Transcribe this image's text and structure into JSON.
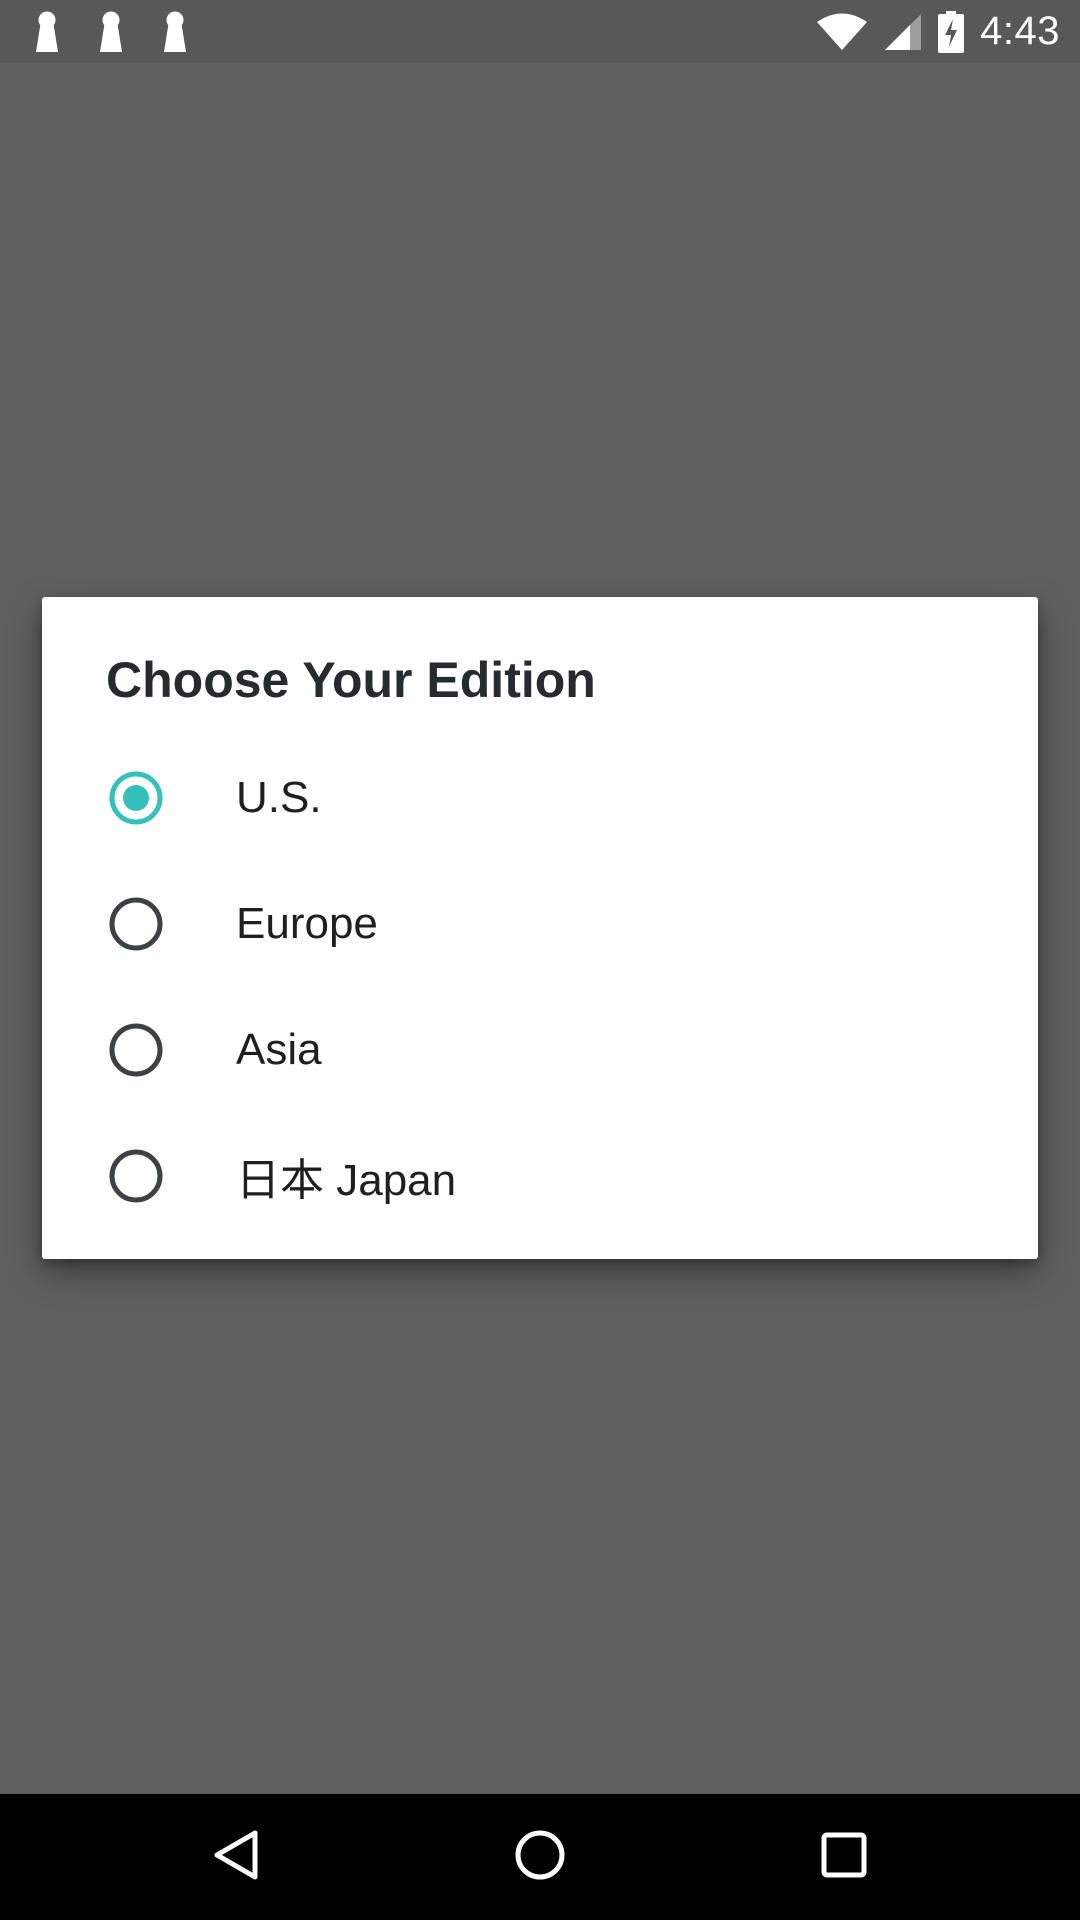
{
  "status_bar": {
    "time": "4:43",
    "notification_icons": [
      "keyhole-icon",
      "keyhole-icon",
      "keyhole-icon"
    ],
    "system_icons": [
      "wifi-icon",
      "signal-icon",
      "battery-charging-icon"
    ]
  },
  "dialog": {
    "title": "Choose Your Edition",
    "options": [
      {
        "label": "U.S.",
        "selected": true
      },
      {
        "label": "Europe",
        "selected": false
      },
      {
        "label": "Asia",
        "selected": false
      },
      {
        "label": "日本 Japan",
        "selected": false
      }
    ]
  },
  "nav_bar": {
    "buttons": [
      "back-icon",
      "home-icon",
      "recents-icon"
    ]
  },
  "colors": {
    "accent": "#35c0bc",
    "scrim": "#606060",
    "status_bar": "#585858",
    "dialog_background": "#ffffff",
    "radio_unselected": "#3c4244",
    "nav_bar": "#000000"
  }
}
